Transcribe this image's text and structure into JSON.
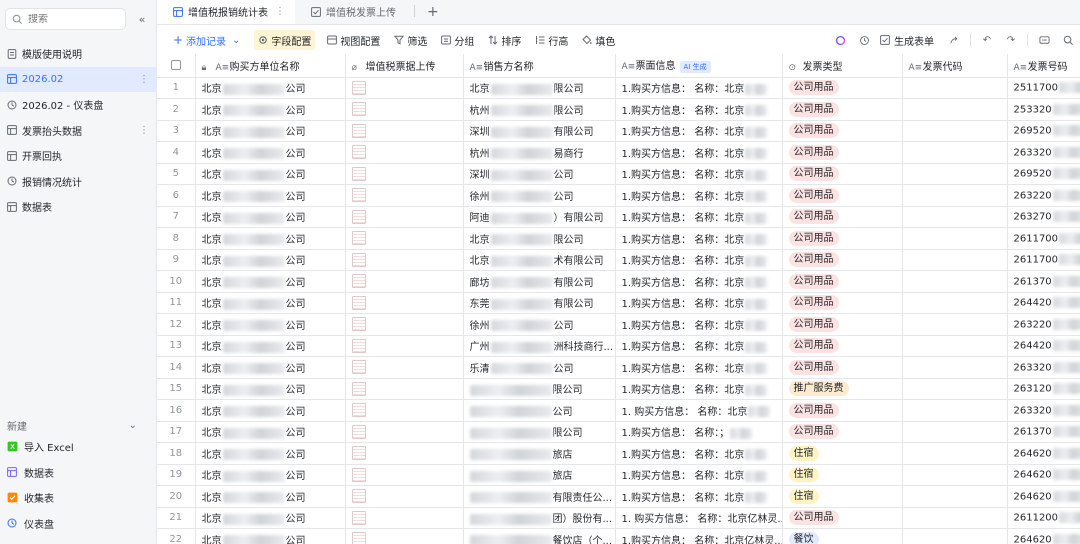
{
  "colors": {
    "accent": "#3370ff",
    "sidebar_bg": "#f5f6f7",
    "active_bg": "#e1eaff",
    "highlight_bg": "#fff4d4"
  },
  "sidebar": {
    "search_placeholder": "搜索",
    "items": [
      {
        "label": "模版使用说明",
        "icon": "doc-icon"
      },
      {
        "label": "2026.02",
        "icon": "table-icon",
        "active": true
      },
      {
        "label": "2026.02 - 仪表盘",
        "icon": "dashboard-icon"
      },
      {
        "label": "发票抬头数据",
        "icon": "table-icon"
      },
      {
        "label": "开票回执",
        "icon": "table-icon"
      },
      {
        "label": "报销情况统计",
        "icon": "dashboard-icon"
      },
      {
        "label": "数据表",
        "icon": "table-icon"
      }
    ],
    "new_section": {
      "title": "新建",
      "items": [
        {
          "label": "导入 Excel",
          "icon": "excel-icon"
        },
        {
          "label": "数据表",
          "icon": "table-icon"
        },
        {
          "label": "收集表",
          "icon": "form-icon"
        },
        {
          "label": "仪表盘",
          "icon": "dashboard-icon"
        }
      ]
    }
  },
  "tabs": [
    {
      "label": "增值税报销统计表",
      "active": true
    },
    {
      "label": "增值税发票上传",
      "active": false
    }
  ],
  "toolbar": {
    "add_record": "添加记录",
    "field_config": "字段配置",
    "view_config": "视图配置",
    "filter": "筛选",
    "group": "分组",
    "sort": "排序",
    "row_height": "行高",
    "fill_color": "填色",
    "generate_form": "生成表单"
  },
  "table": {
    "columns": [
      "购买方单位名称",
      "增值税票据上传",
      "销售方名称",
      "票面信息",
      "发票类型",
      "发票代码",
      "发票号码"
    ],
    "ai_badge": "AI 生成",
    "rows": [
      {
        "idx": "1",
        "buyer_pre": "北京",
        "buyer_suf": "公司",
        "seller_pre": "北京",
        "seller_suf": "限公司",
        "info": "1.购买方信息： 名称：北京",
        "type": "公司用品",
        "tag": "red",
        "number": "2511700"
      },
      {
        "idx": "2",
        "buyer_pre": "北京",
        "buyer_suf": "公司",
        "seller_pre": "杭州",
        "seller_suf": "限公司",
        "info": "1.购买方信息： 名称：北京",
        "type": "公司用品",
        "tag": "red",
        "number": "253320"
      },
      {
        "idx": "3",
        "buyer_pre": "北京",
        "buyer_suf": "公司",
        "seller_pre": "深圳",
        "seller_suf": "有限公司",
        "info": "1.购买方信息： 名称：北京",
        "type": "公司用品",
        "tag": "red",
        "number": "269520"
      },
      {
        "idx": "4",
        "buyer_pre": "北京",
        "buyer_suf": "公司",
        "seller_pre": "杭州",
        "seller_suf": "易商行",
        "info": "1.购买方信息： 名称：北京",
        "type": "公司用品",
        "tag": "red",
        "number": "263320"
      },
      {
        "idx": "5",
        "buyer_pre": "北京",
        "buyer_suf": "公司",
        "seller_pre": "深圳",
        "seller_suf": "公司",
        "info": "1.购买方信息： 名称：北京",
        "type": "公司用品",
        "tag": "red",
        "number": "269520"
      },
      {
        "idx": "6",
        "buyer_pre": "北京",
        "buyer_suf": "公司",
        "seller_pre": "徐州",
        "seller_suf": "公司",
        "info": "1.购买方信息： 名称：北京",
        "type": "公司用品",
        "tag": "red",
        "number": "263220"
      },
      {
        "idx": "7",
        "buyer_pre": "北京",
        "buyer_suf": "公司",
        "seller_pre": "阿迪",
        "seller_suf": "）有限公司",
        "info": "1.购买方信息： 名称：北京",
        "type": "公司用品",
        "tag": "red",
        "number": "263270"
      },
      {
        "idx": "8",
        "buyer_pre": "北京",
        "buyer_suf": "公司",
        "seller_pre": "北京",
        "seller_suf": "限公司",
        "info": "1.购买方信息： 名称：北京",
        "type": "公司用品",
        "tag": "red",
        "number": "2611700"
      },
      {
        "idx": "9",
        "buyer_pre": "北京",
        "buyer_suf": "公司",
        "seller_pre": "北京",
        "seller_suf": "术有限公司",
        "info": "1.购买方信息： 名称：北京",
        "type": "公司用品",
        "tag": "red",
        "number": "2611700"
      },
      {
        "idx": "10",
        "buyer_pre": "北京",
        "buyer_suf": "公司",
        "seller_pre": "廊坊",
        "seller_suf": "有限公司",
        "info": "1.购买方信息： 名称：北京",
        "type": "公司用品",
        "tag": "red",
        "number": "261370"
      },
      {
        "idx": "11",
        "buyer_pre": "北京",
        "buyer_suf": "公司",
        "seller_pre": "东莞",
        "seller_suf": "有限公司",
        "info": "1.购买方信息： 名称：北京",
        "type": "公司用品",
        "tag": "red",
        "number": "264420"
      },
      {
        "idx": "12",
        "buyer_pre": "北京",
        "buyer_suf": "公司",
        "seller_pre": "徐州",
        "seller_suf": "公司",
        "info": "1.购买方信息： 名称：北京",
        "type": "公司用品",
        "tag": "red",
        "number": "263220"
      },
      {
        "idx": "13",
        "buyer_pre": "北京",
        "buyer_suf": "公司",
        "seller_pre": "广州",
        "seller_suf": "洲科技商行...",
        "info": "1.购买方信息： 名称：北京",
        "type": "公司用品",
        "tag": "red",
        "number": "264420"
      },
      {
        "idx": "14",
        "buyer_pre": "北京",
        "buyer_suf": "公司",
        "seller_pre": "乐清",
        "seller_suf": "公司",
        "info": "1.购买方信息： 名称：北京",
        "type": "公司用品",
        "tag": "red",
        "number": "263320"
      },
      {
        "idx": "15",
        "buyer_pre": "北京",
        "buyer_suf": "公司",
        "seller_pre": "",
        "seller_suf": "限公司",
        "info": "1.购买方信息： 名称：北京",
        "type": "推广服务费",
        "tag": "orange",
        "number": "263120"
      },
      {
        "idx": "16",
        "buyer_pre": "北京",
        "buyer_suf": "公司",
        "seller_pre": "",
        "seller_suf": "公司",
        "info": "1. 购买方信息： 名称：北京",
        "type": "公司用品",
        "tag": "red",
        "number": "263320"
      },
      {
        "idx": "17",
        "buyer_pre": "北京",
        "buyer_suf": "公司",
        "seller_pre": "",
        "seller_suf": "限公司",
        "info": "1.购买方信息： 名称：；",
        "type": "公司用品",
        "tag": "red",
        "number": "261370"
      },
      {
        "idx": "18",
        "buyer_pre": "北京",
        "buyer_suf": "公司",
        "seller_pre": "",
        "seller_suf": "旅店",
        "info": "1.购买方信息： 名称：北京",
        "type": "住宿",
        "tag": "yellow",
        "number": "264620"
      },
      {
        "idx": "19",
        "buyer_pre": "北京",
        "buyer_suf": "公司",
        "seller_pre": "",
        "seller_suf": "旅店",
        "info": "1.购买方信息： 名称：北京",
        "type": "住宿",
        "tag": "yellow",
        "number": "264620"
      },
      {
        "idx": "20",
        "buyer_pre": "北京",
        "buyer_suf": "公司",
        "seller_pre": "",
        "seller_suf": "有限责任公...",
        "info": "1.购买方信息： 名称：北京",
        "type": "住宿",
        "tag": "yellow",
        "number": "264620"
      },
      {
        "idx": "21",
        "buyer_pre": "北京",
        "buyer_suf": "公司",
        "seller_pre": "",
        "seller_suf": "团）股份有...",
        "info": "1. 购买方信息： 名称：北京亿林灵...",
        "type": "公司用品",
        "tag": "red",
        "number": "2611200"
      },
      {
        "idx": "22",
        "buyer_pre": "北京",
        "buyer_suf": "公司",
        "seller_pre": "",
        "seller_suf": "餐饮店（个...",
        "info": "1.购买方信息： 名称：北京亿林灵...",
        "type": "餐饮",
        "tag": "blue",
        "number": "264620"
      }
    ]
  }
}
